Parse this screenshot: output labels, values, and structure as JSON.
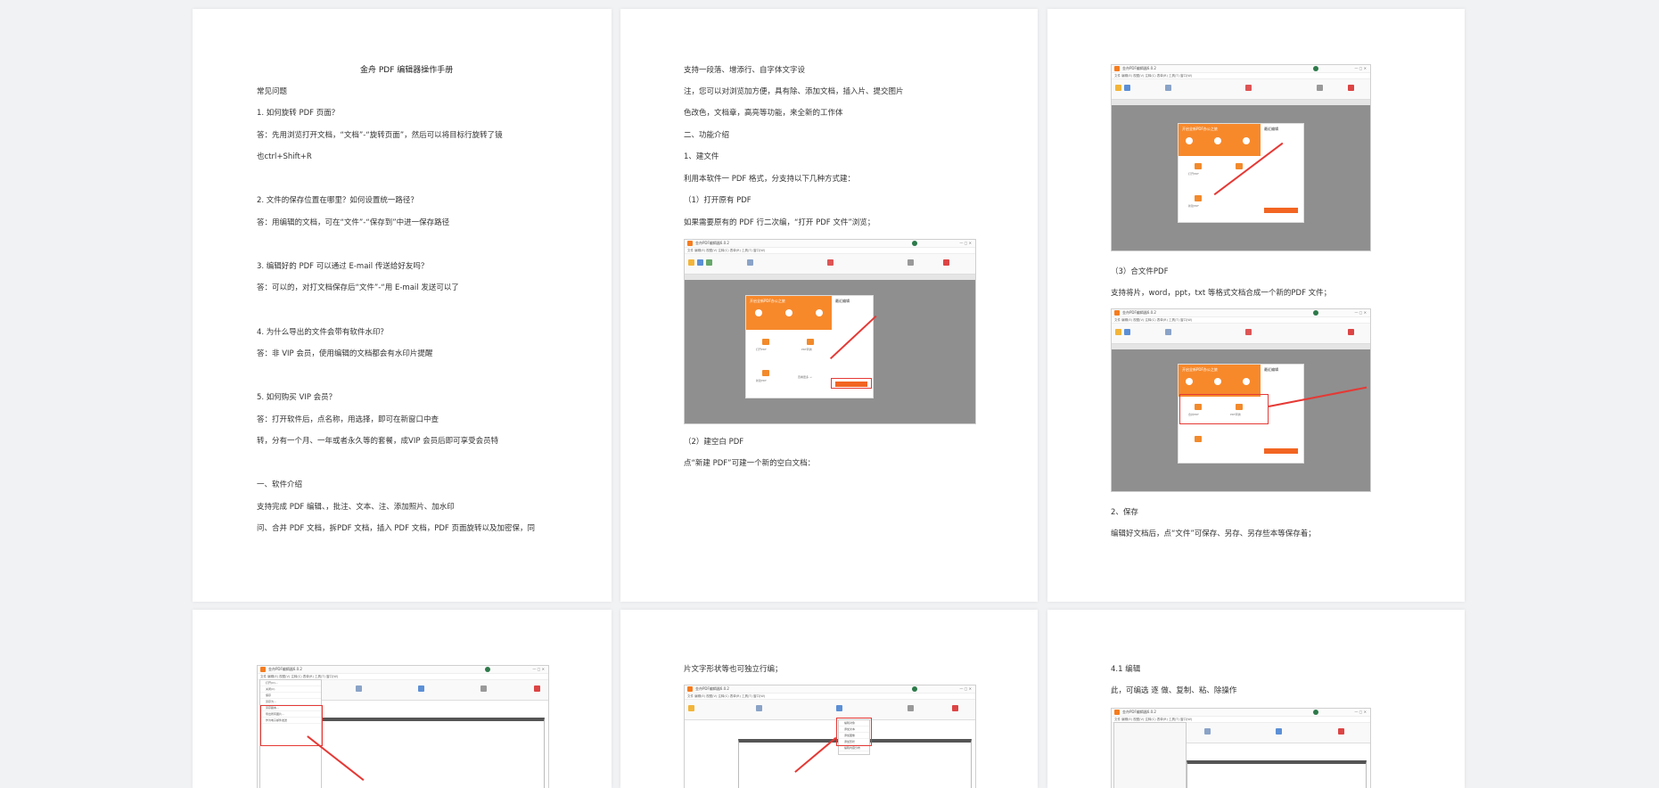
{
  "pages": [
    {
      "lines": [
        "金舟 PDF 编辑器操作手册",
        "常见问题",
        "1. 如何旋转 PDF 页面？",
        "答：先用浏览打开文档，“文档”-“旋转页面”，然后可以将目标行旋转了镜",
        "也ctrl+Shift+R",
        "2. 文件的保存位置在哪里？如何设置统一路径？",
        "答：用编辑的文档，可在“文件”-“保存到”中进一保存路径",
        "3. 编辑好的 PDF 可以通过 E-mail 传送给好友吗？",
        "答：可以的，对打文档保存后“文件”-“用 E-mail 发送可以了",
        "4. 为什么导出的文件会带有软件水印？",
        "答：非 VIP 会员，使用编辑的文档都会有水印片提醒",
        "5. 如何购买 VIP 会员？",
        "答：打开软件后，点名称，用选择，即可在新窗口中查",
        "转，分有一个月、一年或者永久等的套餐，成VIP 会员后即可享受会员特",
        "一、软件介绍",
        "支持完成 PDF 编辑、，批注、文本、注、添加照片、加水印",
        "问、合并 PDF 文档，拆PDF 文档，插入 PDF 文档，PDF 页面旋转以及加密保，同"
      ]
    },
    {
      "lines": [
        "支持一段落、增添行、自字体文字设",
        "注，您可以对浏览加方便，具有除、添加文档，插入片、提交图片",
        "色改色，文档章，高亮等功能，来全新的工作体",
        "二、功能介绍",
        "1、建文件",
        "利用本软件一 PDF 格式，分支持以下几种方式建：",
        "（1）打开原有 PDF",
        "如果需要原有的 PDF 行二次编，“打开 PDF 文件”浏览；",
        "（2）建空白 PDF",
        "点“新建 PDF”可建一个新的空白文档："
      ]
    },
    {
      "lines": [
        "（3）合文件PDF",
        "支持将片，word，ppt，txt 等格式文档合成一个新的PDF 文件；",
        "2、保存",
        "编辑好文档后，点“文件”可保存、另存、另存些本等保存着；"
      ]
    },
    {
      "lines": []
    },
    {
      "lines": [
        "片文字形状等也可独立行编；"
      ]
    },
    {
      "lines": [
        "4.1 编辑",
        "此，可编选 逐 做、复制、粘、除操作"
      ]
    }
  ],
  "app": {
    "window_title": "金舟PDF编辑器6.0.2",
    "menu_bar": "文件  编辑(E)  视图(V)  注释(C)  表单(R)  工具(T)  窗口(W)",
    "user": "ryan",
    "welcome_title": "开启全新PDF办公之旅",
    "recent": "最近编辑",
    "open_pdf": "打开PDF",
    "new_pdf": "新建PDF",
    "merge_pdf": "合并PDF",
    "pdf_convert": "PDF转换",
    "open_btn": "打开PDF文件",
    "more": "查看更多 →",
    "clear": "清空",
    "file_menu_items": [
      "打开(O)...",
      "关闭(C)",
      "保存",
      "另存为...",
      "另存副本...",
      "导出所有图片...",
      "作为电子邮件发送"
    ],
    "shape_menu_items": [
      "编辑对象",
      "添加文本",
      "添加图像",
      "添加形状",
      "编辑内容分布"
    ]
  },
  "colors": {
    "accent_orange": "#f7892b",
    "highlight_red": "#e53935",
    "background": "#f1f2f4"
  }
}
